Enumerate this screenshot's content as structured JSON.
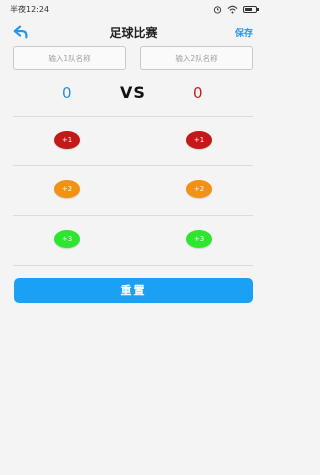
{
  "status_bar": {
    "time": "半夜12:24",
    "icons": [
      "alarm-icon",
      "wifi-icon",
      "battery-icon"
    ],
    "battery_level": 0.7
  },
  "header": {
    "back_icon": "back-arrow-icon",
    "title": "足球比赛",
    "save_label": "保存"
  },
  "teams": {
    "team1_placeholder": "输入1队名称",
    "team2_placeholder": "输入2队名称",
    "team1_value": "",
    "team2_value": ""
  },
  "scoreboard": {
    "team1_score": "0",
    "vs_label": "VS",
    "team2_score": "0"
  },
  "point_buttons": {
    "plus1": "+1",
    "plus2": "+2",
    "plus3": "+3"
  },
  "reset_label": "重置",
  "colors": {
    "accent": "#1aa0f5",
    "team1_score": "#2b8fd0",
    "team2_score": "#c62020",
    "plus1": "#c21919",
    "plus2": "#f29213",
    "plus3": "#2ee62e"
  }
}
